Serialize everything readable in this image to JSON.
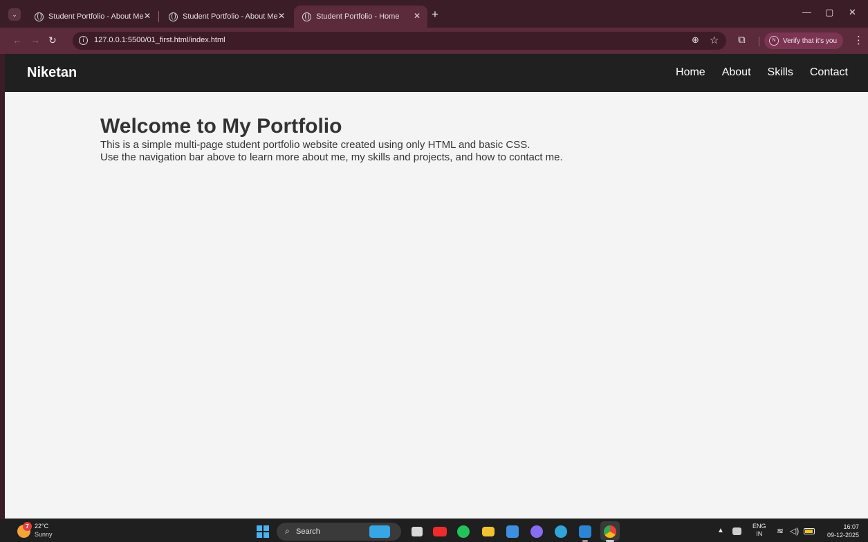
{
  "browser": {
    "tabs": [
      {
        "title": "Student Portfolio - About Me",
        "active": false
      },
      {
        "title": "Student Portfolio - About Me",
        "active": false
      },
      {
        "title": "Student Portfolio - Home",
        "active": true
      }
    ],
    "new_tab_label": "+",
    "address": "127.0.0.1:5500/01_first.html/index.html",
    "profile_initial": "N",
    "profile_label": "Verify that it's you",
    "colors": {
      "frame": "#3b1d27",
      "toolbar": "#5b2a3b",
      "omnibox": "#3d1c28",
      "profile": "#7b3552"
    }
  },
  "page": {
    "brand": "Niketan",
    "nav": [
      "Home",
      "About",
      "Skills",
      "Contact"
    ],
    "heading": "Welcome to My Portfolio",
    "paragraph_1": "This is a simple multi-page student portfolio website created using only HTML and basic CSS.",
    "paragraph_2": "Use the navigation bar above to learn more about me, my skills and projects, and how to contact me.",
    "colors": {
      "header_bg": "#202020",
      "page_bg": "#f4f4f4",
      "text": "#333333"
    }
  },
  "taskbar": {
    "weather_badge": "7",
    "temperature": "22°C",
    "condition": "Sunny",
    "search_label": "Search",
    "language": "ENG",
    "region": "IN",
    "time": "16:07",
    "date": "09-12-2025",
    "apps": [
      "widgets",
      "task-view",
      "youtube",
      "whatsapp",
      "file-explorer",
      "microsoft-store",
      "copilot",
      "edge",
      "vscode",
      "chrome"
    ]
  }
}
